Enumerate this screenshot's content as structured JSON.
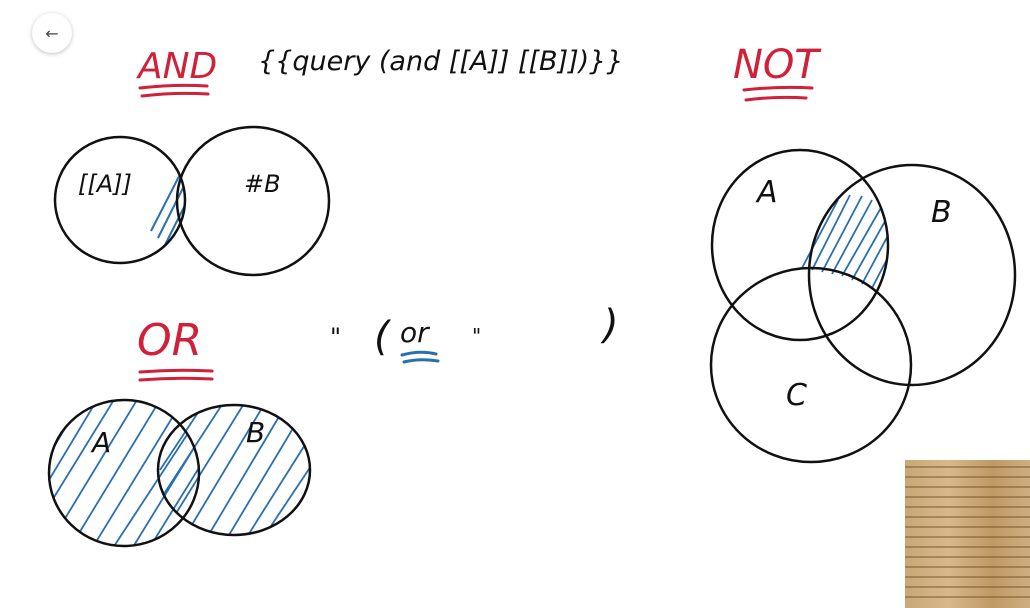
{
  "toolbar": {
    "back_icon": "arrow-left-icon",
    "back_glyph": "←"
  },
  "colors": {
    "ink": "#111111",
    "accent_red": "#d0203a",
    "accent_blue": "#2a6fb0"
  },
  "titles": {
    "and": "AND",
    "or": "OR",
    "not": "NOT"
  },
  "query": {
    "and_text": "{{query (and [[A]] [[B]])}}",
    "or_quote_left": "\"",
    "or_paren_open": "(",
    "or_word": "or",
    "or_quote_right": "\"",
    "or_paren_close": ")"
  },
  "and_diagram": {
    "left_label": "[[A]]",
    "right_label": "#B"
  },
  "or_diagram": {
    "left_label": "A",
    "right_label": "B"
  },
  "not_diagram": {
    "label_a": "A",
    "label_b": "B",
    "label_c": "C"
  },
  "thumbnail": {
    "icon": "window-blinds-image"
  }
}
